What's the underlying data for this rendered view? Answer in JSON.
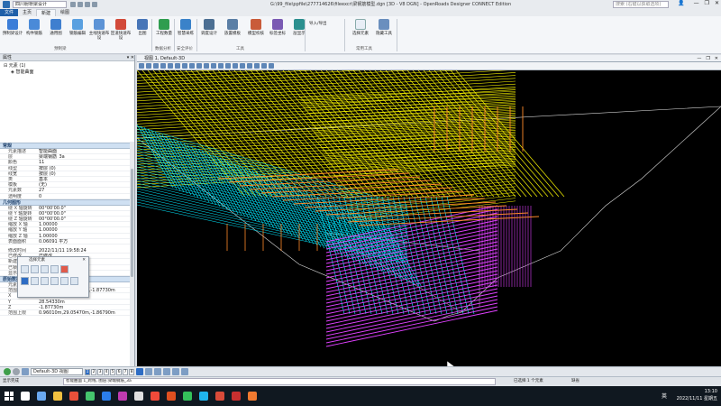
{
  "titlebar": {
    "workspace": "四川射桥梁设计",
    "window_title": "G:\\99_file\\ppfile\\277714626\\fileexcr\\梁钢筋模型.dgn [3D - V8 DGN] - OpenRoads Designer CONNECT Edition",
    "search_placeholder": "搜索 (右键以获取选项)",
    "window_buttons": [
      "—",
      "❐",
      "✕"
    ]
  },
  "ribbon_tabs": [
    "文件",
    "主页",
    "新建",
    "绘图"
  ],
  "ribbon": {
    "buttons": [
      {
        "label": "预制梁设计",
        "color": "#3b7dd8"
      },
      {
        "label": "构件钢筋",
        "color": "#4a8ad8"
      },
      {
        "label": "通用图",
        "color": "#3f7fcf"
      },
      {
        "label": "钢筋编辑",
        "color": "#5aa0e0"
      },
      {
        "label": "主线快速布设",
        "color": "#5c93d6"
      },
      {
        "label": "匝道快速布设",
        "color": "#d24a3a"
      },
      {
        "label": "出图",
        "color": "#4876b8"
      },
      {
        "label": "工程数量",
        "color": "#2f9d4f"
      },
      {
        "label": "智慧采练",
        "color": "#3a82c9"
      },
      {
        "label": "调度设计",
        "color": "#4c6f93"
      },
      {
        "label": "族置模板",
        "color": "#5b7fa6"
      },
      {
        "label": "模型校核",
        "color": "#c95b3a"
      },
      {
        "label": "标签坐标",
        "color": "#7a5ab3"
      },
      {
        "label": "层显示",
        "color": "#2b8f8f"
      }
    ],
    "import_export": "导入/导出",
    "select_element": "选择元素",
    "clear_tools": "隐藏工具",
    "groups": [
      "预制梁",
      "数据分析",
      "安全评价",
      "工具",
      "常用工具"
    ]
  },
  "left_panel": {
    "title": "属性",
    "tree": [
      "元素 (1)",
      "智能曲面"
    ],
    "section_general": "常规",
    "general_rows": [
      {
        "k": "元素描述",
        "v": "智能曲面"
      },
      {
        "k": "层",
        "v": "梁端钢筋_3a"
      },
      {
        "k": "颜色",
        "v": "11"
      },
      {
        "k": "线型",
        "v": "按层 (0)"
      },
      {
        "k": "线宽",
        "v": "按层 (0)"
      },
      {
        "k": "类",
        "v": "基本"
      },
      {
        "k": "模板",
        "v": "(无)"
      },
      {
        "k": "元素数",
        "v": "27"
      },
      {
        "k": "透明度",
        "v": "0"
      }
    ],
    "section_geometry": "几何图形",
    "geometry_rows": [
      {
        "k": "绕 X 轴旋转",
        "v": "00°00'00.0\""
      },
      {
        "k": "绕 Y 轴旋转",
        "v": "00°00'00.0\""
      },
      {
        "k": "绕 Z 轴旋转",
        "v": "00°00'00.0\""
      },
      {
        "k": "缩放 X 轴",
        "v": "1.00000"
      },
      {
        "k": "缩放 Y 轴",
        "v": "1.00000"
      },
      {
        "k": "缩放 Z 轴",
        "v": "1.00000"
      },
      {
        "k": "表面面积",
        "v": "0.06091 平方"
      }
    ],
    "extra_rows": [
      {
        "k": "修改时间",
        "v": "2022/11/11 19:58:24"
      },
      {
        "k": "已修改",
        "v": "已修改"
      },
      {
        "k": "新建",
        "v": "非新建"
      },
      {
        "k": "已锁定",
        "v": "解锁"
      },
      {
        "k": "显示样式",
        "v": "(从视图 显示)"
      }
    ],
    "section_raw": "原始数据",
    "raw_rows": [
      {
        "k": "元素标识",
        "v": "7271050"
      },
      {
        "k": "范围下限",
        "v": "0.05530m,28.54330m,-1.87730m"
      },
      {
        "k": "X",
        "v": "0.05530m"
      },
      {
        "k": "Y",
        "v": "28.54330m"
      },
      {
        "k": "Z",
        "v": "-1.87730m"
      },
      {
        "k": "范围上限",
        "v": "0.96010m,29.05470m,-1.86790m"
      }
    ]
  },
  "toolbox": {
    "title": "选择元素"
  },
  "view": {
    "title": "视图 1, Default-3D",
    "buttons": [
      "—",
      "❐",
      "✕"
    ]
  },
  "viewbar": {
    "dropdown": "Default-3D 视图",
    "views": [
      "1",
      "2",
      "3",
      "4",
      "5",
      "6",
      "7",
      "8"
    ]
  },
  "statusbar": {
    "left": "显示完成",
    "message": "智能曲面 1_跨线, 图层:梁端钢筋_3a",
    "mid": "已选择 1 个元素",
    "right": "缺省"
  },
  "taskbar": {
    "ime": "英",
    "time": "13:10",
    "date": "2022/11/11 星期五",
    "icon_colors": [
      "#ffffff",
      "#6aa9f0",
      "#f0c040",
      "#e8503a",
      "#45c56d",
      "#2b7de9",
      "#c03bb0",
      "#e0e0e0",
      "#f04a3a",
      "#e05020",
      "#34c15a",
      "#1fb5ee",
      "#d94b39",
      "#c82f2f",
      "#f07a30"
    ]
  },
  "colors": {
    "accent": "#1f5fa8",
    "yellow_rebar": "#f5f000",
    "cyan_rebar": "#00e8ff",
    "magenta_rebar": "#e040ff",
    "orange_rebar": "#ff8a2a"
  }
}
